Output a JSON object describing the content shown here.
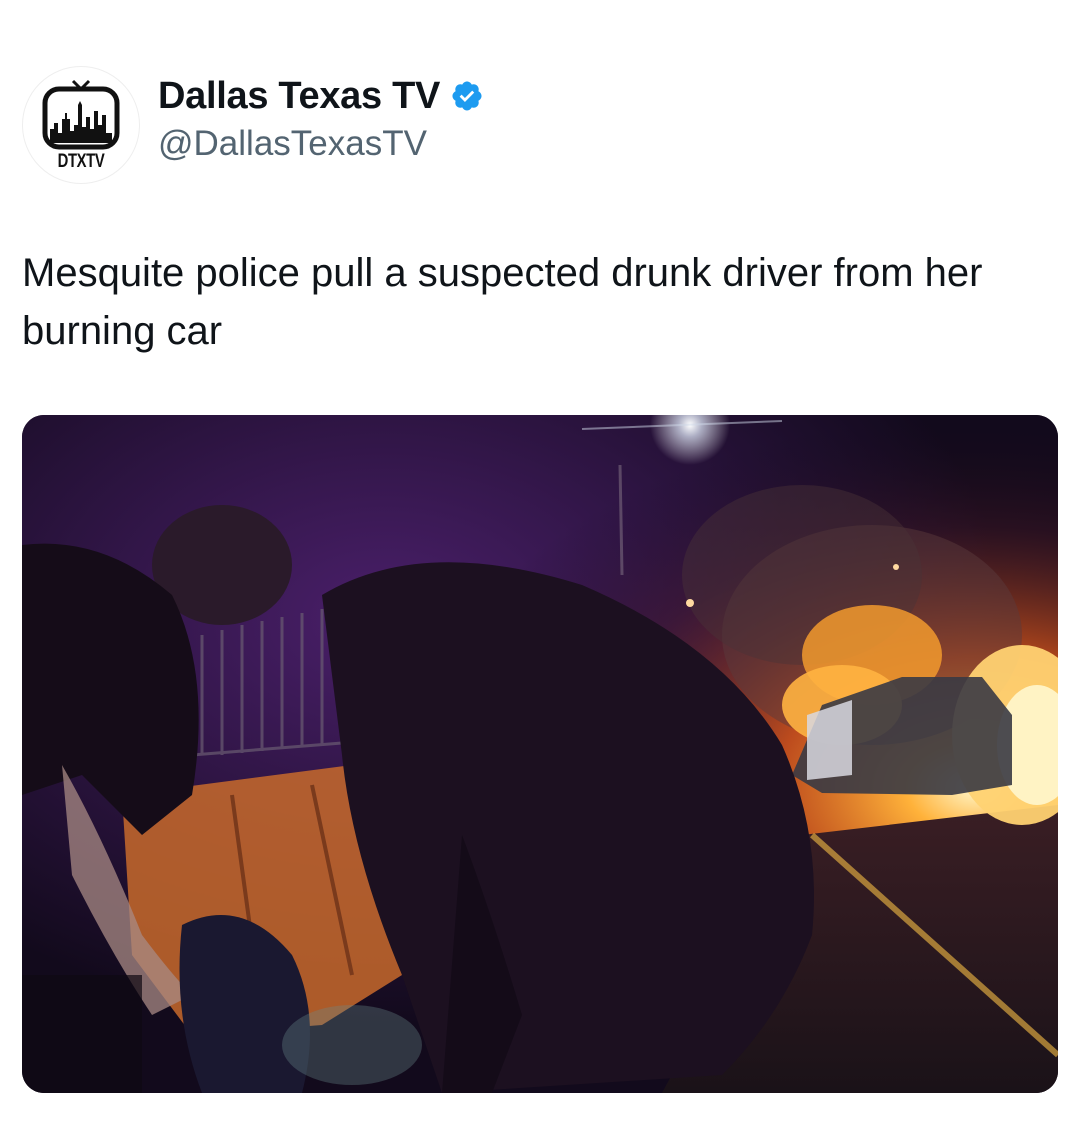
{
  "account": {
    "display_name": "Dallas Texas TV",
    "handle": "@DallasTexasTV",
    "verified_icon": "verified-badge-icon",
    "avatar_logo_text": "DTXTV"
  },
  "tweet": {
    "text": "Mesquite police pull a suspected drunk driver from her burning car"
  },
  "media": {
    "alt": "Night bodycam footage: officers pull a person away from a car engulfed in flames on a roadway beside orange barriers"
  },
  "colors": {
    "verified_blue": "#1d9bf0",
    "handle_gray": "#536471",
    "text_black": "#0f1419",
    "fire_orange": "#ff9a1f"
  }
}
